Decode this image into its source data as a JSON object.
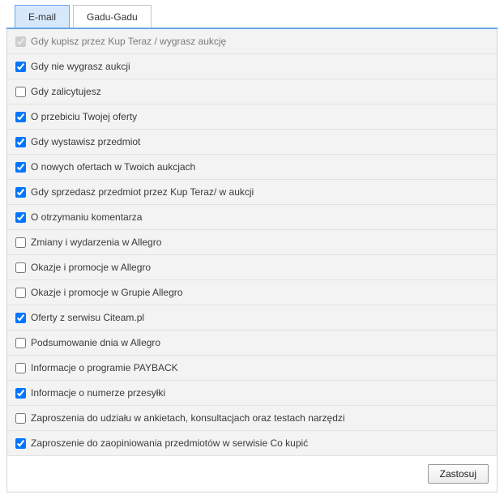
{
  "tabs": [
    {
      "label": "E-mail",
      "active": true
    },
    {
      "label": "Gadu-Gadu",
      "active": false
    }
  ],
  "options": [
    {
      "label": "Gdy kupisz przez Kup Teraz / wygrasz aukcję",
      "checked": true,
      "disabled": true
    },
    {
      "label": "Gdy nie wygrasz aukcji",
      "checked": true,
      "disabled": false
    },
    {
      "label": "Gdy zalicytujesz",
      "checked": false,
      "disabled": false
    },
    {
      "label": "O przebiciu Twojej oferty",
      "checked": true,
      "disabled": false
    },
    {
      "label": "Gdy wystawisz przedmiot",
      "checked": true,
      "disabled": false
    },
    {
      "label": "O nowych ofertach w Twoich aukcjach",
      "checked": true,
      "disabled": false
    },
    {
      "label": "Gdy sprzedasz przedmiot przez Kup Teraz/ w aukcji",
      "checked": true,
      "disabled": false
    },
    {
      "label": "O otrzymaniu komentarza",
      "checked": true,
      "disabled": false
    },
    {
      "label": "Zmiany i wydarzenia w Allegro",
      "checked": false,
      "disabled": false
    },
    {
      "label": "Okazje i promocje w Allegro",
      "checked": false,
      "disabled": false
    },
    {
      "label": "Okazje i promocje w Grupie Allegro",
      "checked": false,
      "disabled": false
    },
    {
      "label": "Oferty z serwisu Citeam.pl",
      "checked": true,
      "disabled": false
    },
    {
      "label": "Podsumowanie dnia w Allegro",
      "checked": false,
      "disabled": false
    },
    {
      "label": "Informacje o programie PAYBACK",
      "checked": false,
      "disabled": false
    },
    {
      "label": "Informacje o numerze przesyłki",
      "checked": true,
      "disabled": false
    },
    {
      "label": "Zaproszenia do udziału w ankietach, konsultacjach oraz testach narzędzi",
      "checked": false,
      "disabled": false
    },
    {
      "label": "Zaproszenie do zaopiniowania przedmiotów w serwisie Co kupić",
      "checked": true,
      "disabled": false
    }
  ],
  "footer": {
    "apply_label": "Zastosuj"
  }
}
